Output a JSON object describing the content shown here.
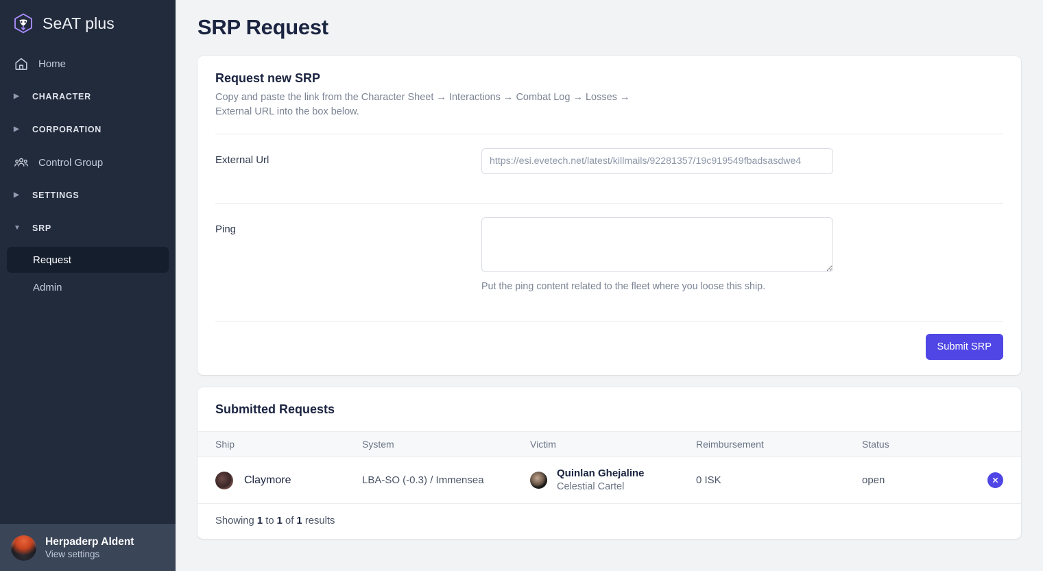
{
  "sidebar": {
    "brand": {
      "name": "SeAT plus",
      "logo_icon": "cube-logo-icon",
      "accent": "#a78bfa"
    },
    "items": [
      {
        "label": "Home",
        "icon": "home-icon",
        "type": "link"
      },
      {
        "label": "CHARACTER",
        "icon": "caret-right-icon",
        "type": "section",
        "expanded": false
      },
      {
        "label": "CORPORATION",
        "icon": "caret-right-icon",
        "type": "section",
        "expanded": false
      },
      {
        "label": "Control Group",
        "icon": "users-group-icon",
        "type": "link"
      },
      {
        "label": "SETTINGS",
        "icon": "caret-right-icon",
        "type": "section",
        "expanded": false
      },
      {
        "label": "SRP",
        "icon": "caret-down-icon",
        "type": "section",
        "expanded": true
      }
    ],
    "srp_children": [
      {
        "label": "Request",
        "active": true
      },
      {
        "label": "Admin",
        "active": false
      }
    ],
    "caret_right": "▶",
    "caret_down": "▼",
    "user": {
      "name": "Herpaderp Aldent",
      "subtitle": "View settings",
      "avatar_icon": "user-avatar"
    }
  },
  "page": {
    "title": "SRP Request"
  },
  "request_card": {
    "title": "Request new SRP",
    "description": "Copy and paste the link from the Character Sheet → Interactions → Combat Log → Losses → External URL into the box below.",
    "external_url": {
      "label": "External Url",
      "value": "",
      "placeholder": "https://esi.evetech.net/latest/killmails/92281357/19c919549fbadsasdwe4"
    },
    "ping": {
      "label": "Ping",
      "value": "",
      "placeholder": "",
      "help": "Put the ping content related to the fleet where you loose this ship."
    },
    "submit_label": "Submit SRP",
    "submit_color": "#4f46e5"
  },
  "submitted": {
    "title": "Submitted Requests",
    "columns": [
      "Ship",
      "System",
      "Victim",
      "Reimbursement",
      "Status",
      ""
    ],
    "rows": [
      {
        "ship": "Claymore",
        "system": "LBA-SO (-0.3) / Immensea",
        "victim_name": "Quinlan Ghejaline",
        "victim_corp": "Celestial Cartel",
        "reimbursement": "0 ISK",
        "status": "open",
        "action_icon": "delete-circle-icon"
      }
    ],
    "footer": {
      "prefix": "Showing ",
      "from": "1",
      "mid1": " to ",
      "to": "1",
      "mid2": " of ",
      "total": "1",
      "suffix": " results"
    }
  }
}
